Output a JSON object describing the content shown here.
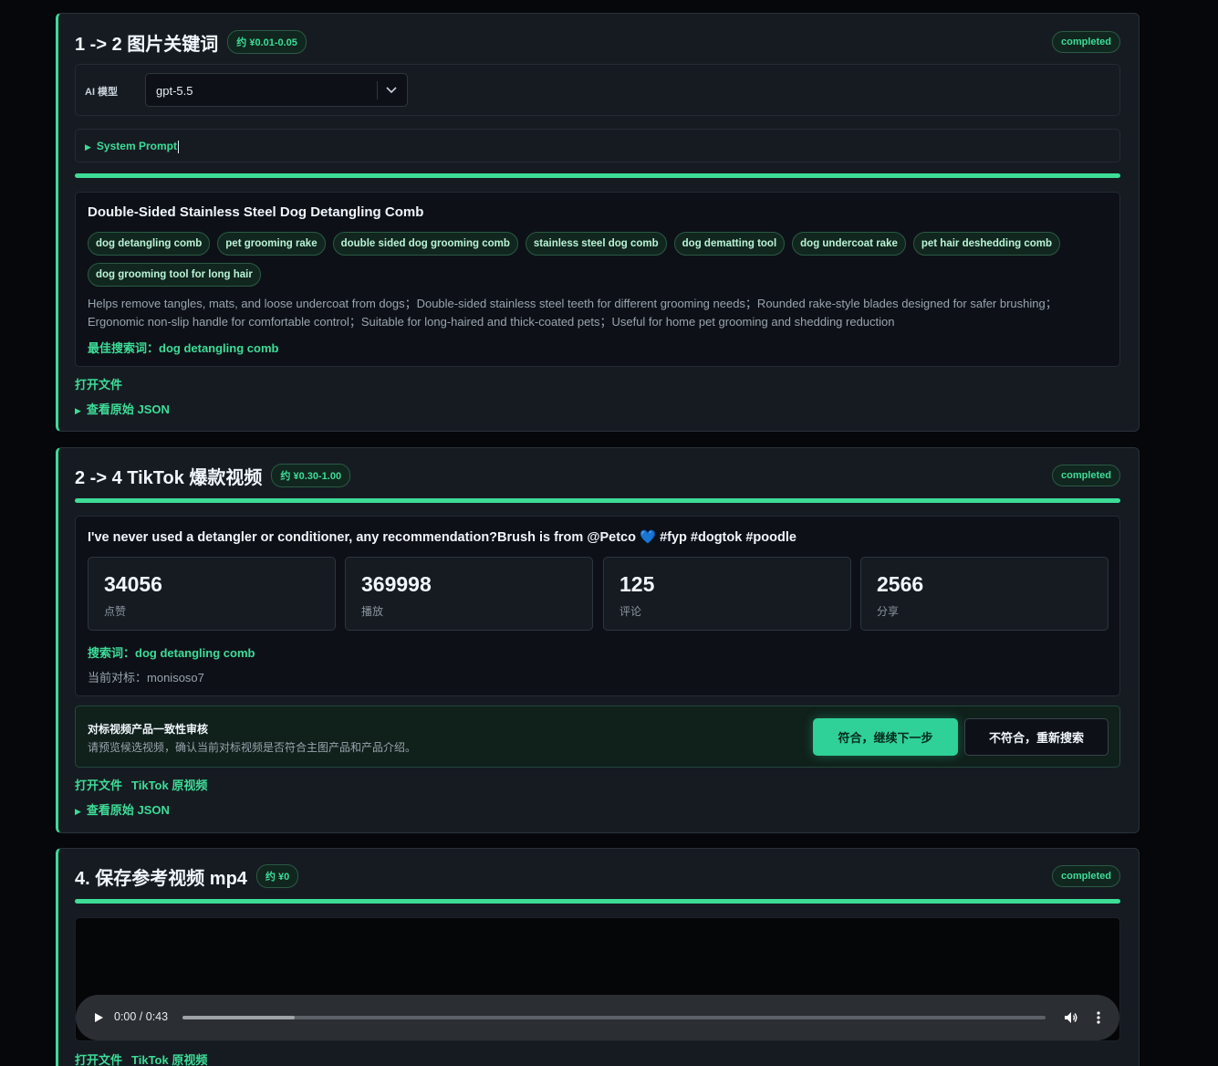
{
  "card1": {
    "title": "1 -> 2 图片关键词",
    "cost": "约 ¥0.01-0.05",
    "status": "completed",
    "model_label": "AI 模型",
    "model_value": "gpt-5.5",
    "system_prompt_label": "System Prompt",
    "progress": 1.0,
    "product_title": "Double-Sided Stainless Steel Dog Detangling Comb",
    "tags": [
      "dog detangling comb",
      "pet grooming rake",
      "double sided dog grooming comb",
      "stainless steel dog comb",
      "dog dematting tool",
      "dog undercoat rake",
      "pet hair deshedding comb",
      "dog grooming tool for long hair"
    ],
    "description": "Helps remove tangles, mats, and loose undercoat from dogs；Double-sided stainless steel teeth for different grooming needs；Rounded rake-style blades designed for safer brushing；Ergonomic non-slip handle for comfortable control；Suitable for long-haired and thick-coated pets；Useful for home pet grooming and shedding reduction",
    "best_keyword_label": "最佳搜索词：",
    "best_keyword": "dog detangling comb",
    "open_file": "打开文件",
    "raw_json": "查看原始 JSON"
  },
  "card2": {
    "title": "2 -> 4 TikTok 爆款视频",
    "cost": "约 ¥0.30-1.00",
    "status": "completed",
    "progress": 1.0,
    "video_caption": "I've never used a detangler or conditioner, any recommendation?Brush is from @Petco 💙 #fyp #dogtok #poodle",
    "stats": [
      {
        "value": "34056",
        "label": "点赞"
      },
      {
        "value": "369998",
        "label": "播放"
      },
      {
        "value": "125",
        "label": "评论"
      },
      {
        "value": "2566",
        "label": "分享"
      }
    ],
    "search_label": "搜索词：",
    "search_keyword": "dog detangling comb",
    "benchmark_label": "当前对标：",
    "benchmark_value": "monisoso7",
    "review_title": "对标视频产品一致性审核",
    "review_desc": "请预览候选视频，确认当前对标视频是否符合主图产品和产品介绍。",
    "accept_label": "符合，继续下一步",
    "reject_label": "不符合，重新搜索",
    "open_file": "打开文件",
    "tiktok_link": "TikTok 原视频",
    "raw_json": "查看原始 JSON"
  },
  "card3": {
    "title": "4. 保存参考视频 mp4",
    "cost": "约 ¥0",
    "status": "completed",
    "progress": 1.0,
    "player_time": "0:00 / 0:43",
    "player_progress": 0.13,
    "open_file": "打开文件",
    "tiktok_link": "TikTok 原视频"
  },
  "icons": {
    "play": "play-icon",
    "volume": "volume-icon",
    "more": "more-vertical-icon",
    "chevron": "chevron-down-icon",
    "caret": "caret-right-icon"
  },
  "colors": {
    "accent": "#3ddc97",
    "background": "#05070a",
    "card": "#161b22"
  }
}
